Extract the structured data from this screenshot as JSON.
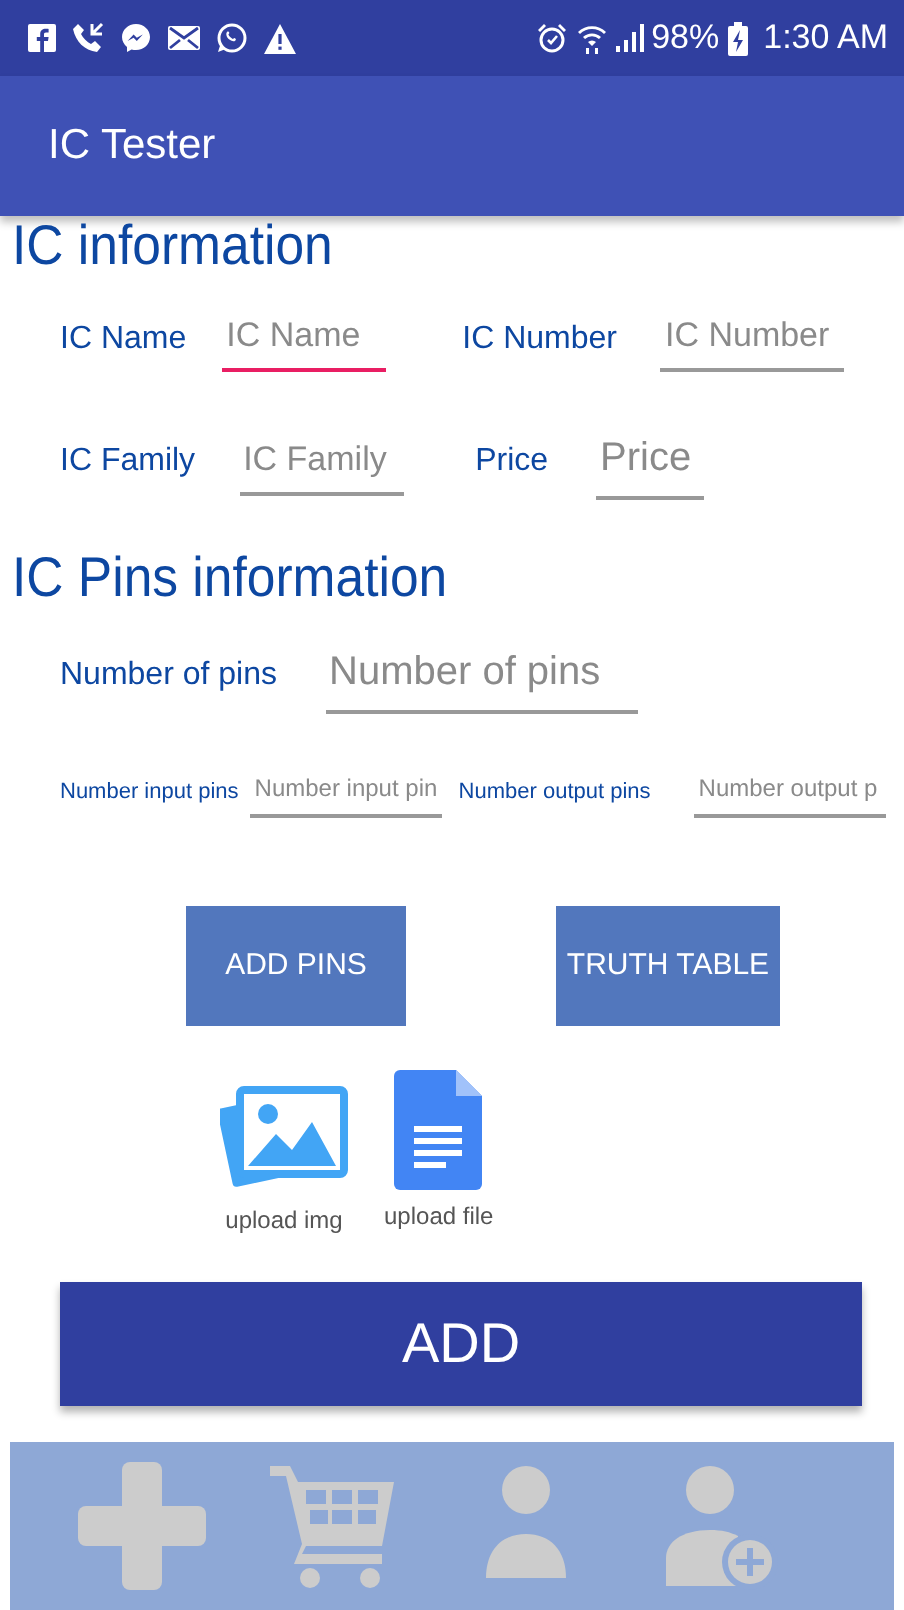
{
  "status_bar": {
    "battery": "98%",
    "time": "1:30 AM"
  },
  "app_bar": {
    "title": "IC Tester"
  },
  "sections": [
    {
      "title": "IC information",
      "rows": [
        [
          {
            "label": "IC Name",
            "placeholder": "IC Name",
            "focused": true
          },
          {
            "label": "IC Number",
            "placeholder": "IC Number",
            "focused": false
          }
        ],
        [
          {
            "label": "IC Family",
            "placeholder": "IC Family",
            "focused": false
          },
          {
            "label": "Price",
            "placeholder": "Price",
            "focused": false
          }
        ]
      ]
    },
    {
      "title": "IC Pins information",
      "rows": [
        [
          {
            "label": "Number of pins",
            "placeholder": "Number of pins",
            "focused": false
          }
        ],
        [
          {
            "label": "Number input pins",
            "placeholder": "Number input pin",
            "focused": false
          },
          {
            "label": "Number output pins",
            "placeholder": "Number output p",
            "focused": false
          }
        ]
      ]
    }
  ],
  "pin_buttons": [
    "ADD PINS",
    "TRUTH TABLE"
  ],
  "uploads": [
    {
      "kind": "image",
      "label": "upload img"
    },
    {
      "kind": "file",
      "label": "upload file"
    }
  ],
  "add_button": "ADD",
  "bottom_nav": [
    {
      "kind": "plus"
    },
    {
      "kind": "cart"
    },
    {
      "kind": "person"
    },
    {
      "kind": "person-add"
    }
  ]
}
